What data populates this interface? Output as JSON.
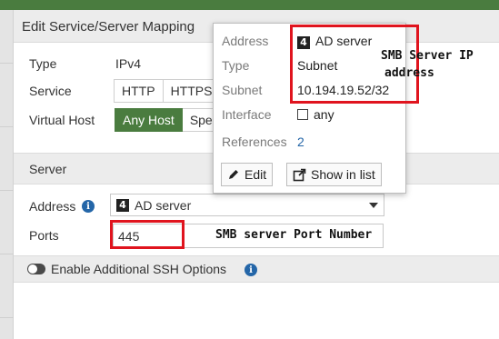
{
  "dialog": {
    "title": "Edit Service/Server Mapping"
  },
  "form": {
    "type_label": "Type",
    "type_value": "IPv4",
    "service_label": "Service",
    "service_options": [
      "HTTP",
      "HTTPS"
    ],
    "virtual_host_label": "Virtual Host",
    "virtual_host_options": [
      "Any Host",
      "Spe"
    ],
    "virtual_host_selected": "Any Host"
  },
  "server": {
    "section_title": "Server",
    "address_label": "Address",
    "address_value": "AD server",
    "address_icon": "4",
    "ports_label": "Ports",
    "ports_value": "445",
    "ssh_toggle_label": "Enable Additional SSH Options",
    "ssh_toggle_state": "off"
  },
  "popup": {
    "address_label": "Address",
    "address_value": "AD server",
    "type_label": "Type",
    "type_value": "Subnet",
    "subnet_label": "Subnet",
    "subnet_value": "10.194.19.52/32",
    "interface_label": "Interface",
    "interface_value": "any",
    "references_label": "References",
    "references_value": "2",
    "edit_button": "Edit",
    "show_in_list_button": "Show in list"
  },
  "annotations": {
    "smb_ip_line1": "SMB Server IP",
    "smb_ip_line2": "address",
    "smb_port": "SMB server Port Number"
  },
  "colors": {
    "accent": "#4a7c3f",
    "link": "#2466a8",
    "highlight": "#e0141e"
  }
}
